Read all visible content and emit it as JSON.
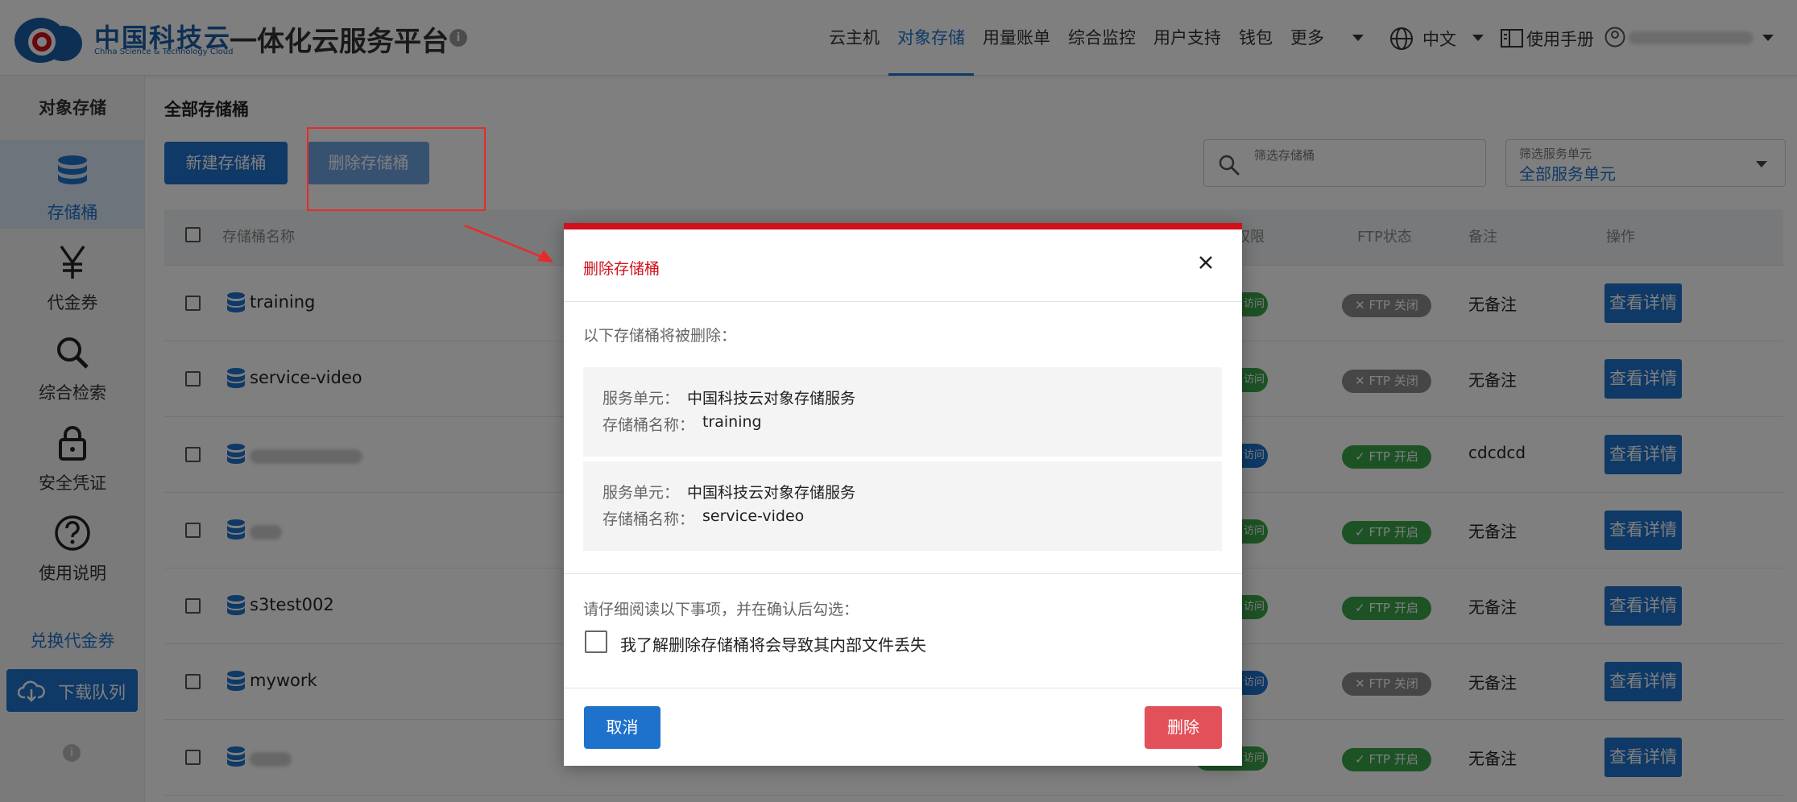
{
  "header": {
    "logo_cn": "中国科技云",
    "logo_en": "China Science & Technology Cloud",
    "platform_title": "一体化云服务平台",
    "info_icon": "i",
    "nav": [
      "云主机",
      "对象存储",
      "用量账单",
      "综合监控",
      "用户支持",
      "钱包",
      "更多"
    ],
    "nav_active": "对象存储",
    "language": "中文",
    "manual": "使用手册"
  },
  "sidebar": {
    "title": "对象存储",
    "items": [
      {
        "label": "存储桶",
        "icon": "database-icon",
        "active": true
      },
      {
        "label": "代金券",
        "icon": "yen-icon"
      },
      {
        "label": "综合检索",
        "icon": "search-icon"
      },
      {
        "label": "安全凭证",
        "icon": "lock-icon"
      },
      {
        "label": "使用说明",
        "icon": "help-icon"
      }
    ],
    "redeem": "兑换代金券",
    "download_queue": "下载队列",
    "info_icon": "i"
  },
  "main": {
    "breadcrumb": "全部存储桶",
    "new_bucket_button": "新建存储桶",
    "delete_bucket_button": "删除存储桶",
    "filter_bucket_placeholder": "筛选存储桶",
    "filter_unit_label": "筛选服务单元",
    "filter_unit_value": "全部服务单元",
    "columns": [
      "存储桶名称",
      "权限",
      "FTP状态",
      "备注",
      "操作"
    ],
    "rows": [
      {
        "name": "training",
        "perm_color": "green",
        "perm": "访问",
        "ftp": "FTP 关闭",
        "ftp_on": false,
        "note": "无备注",
        "action": "查看详情"
      },
      {
        "name": "service-video",
        "perm_color": "green",
        "perm": "访问",
        "ftp": "FTP 关闭",
        "ftp_on": false,
        "note": "无备注",
        "action": "查看详情"
      },
      {
        "name": "",
        "perm_color": "blue",
        "perm": "访问",
        "ftp": "FTP 开启",
        "ftp_on": true,
        "note": "cdcdcd",
        "action": "查看详情"
      },
      {
        "name": "",
        "perm_color": "green",
        "perm": "访问",
        "ftp": "FTP 开启",
        "ftp_on": true,
        "note": "无备注",
        "action": "查看详情"
      },
      {
        "name": "s3test002",
        "perm_color": "green",
        "perm": "访问",
        "ftp": "FTP 开启",
        "ftp_on": true,
        "note": "无备注",
        "action": "查看详情"
      },
      {
        "name": "mywork",
        "perm_color": "blue",
        "perm": "访问",
        "ftp": "FTP 关闭",
        "ftp_on": false,
        "note": "无备注",
        "action": "查看详情"
      },
      {
        "name": "",
        "perm_color": "green",
        "perm": "访问",
        "ftp": "FTP 开启",
        "ftp_on": true,
        "note": "无备注",
        "action": "查看详情"
      }
    ]
  },
  "dialog": {
    "title": "删除存储桶",
    "intro": "以下存储桶将被删除：",
    "unit_label": "服务单元：",
    "bucket_label": "存储桶名称：",
    "buckets": [
      {
        "unit": "中国科技云对象存储服务",
        "name": "training"
      },
      {
        "unit": "中国科技云对象存储服务",
        "name": "service-video"
      }
    ],
    "read_notice": "请仔细阅读以下事项，并在确认后勾选：",
    "agree_text": "我了解删除存储桶将会导致其内部文件丢失",
    "cancel_button": "取消",
    "delete_button": "删除"
  }
}
